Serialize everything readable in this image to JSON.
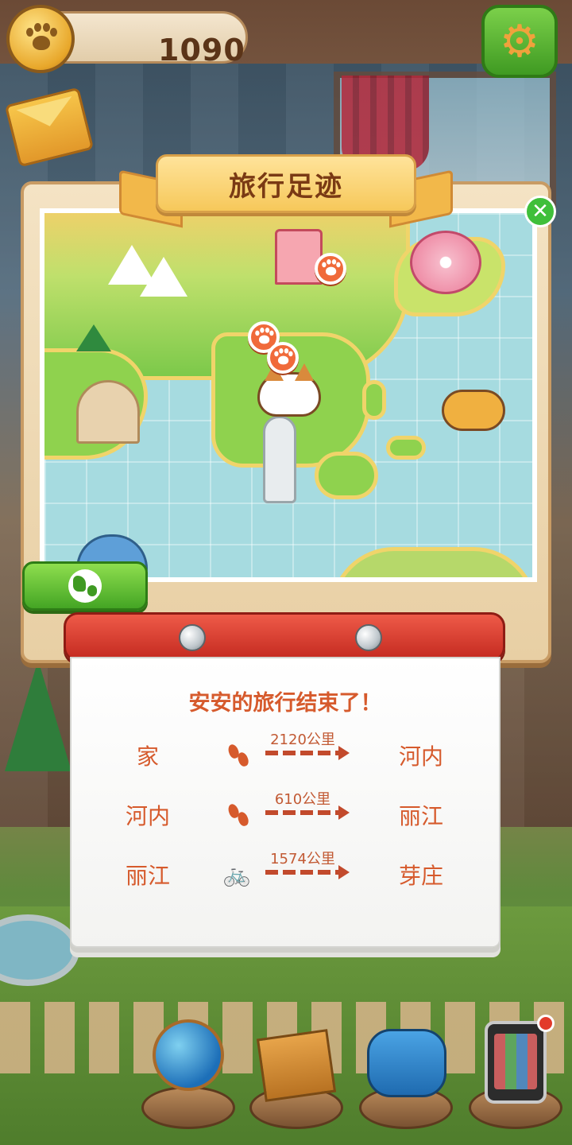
{
  "hud": {
    "coins": "1090",
    "settings_icon": "gear-icon",
    "coin_icon": "paw-coin-icon"
  },
  "panel": {
    "title": "旅行足迹",
    "close_icon": "close-icon",
    "close_glyph": "✕",
    "globe_button_icon": "globe-icon",
    "map_markers": [
      "temple",
      "cherry-blossom",
      "panda",
      "taj-mahal",
      "statue",
      "corgi-pin",
      "boat-dog",
      "shark",
      "kangaroo-dog",
      "opera-house"
    ]
  },
  "summary": {
    "headline": "安安的旅行结束了！",
    "routes": [
      {
        "from": "家",
        "mode": "walk",
        "mode_icon": "footprints-icon",
        "distance": "2120公里",
        "to": "河内"
      },
      {
        "from": "河内",
        "mode": "walk",
        "mode_icon": "footprints-icon",
        "distance": "610公里",
        "to": "丽江"
      },
      {
        "from": "丽江",
        "mode": "bike",
        "mode_icon": "bicycle-icon",
        "mode_glyph": "🚲",
        "distance": "1574公里",
        "to": "芽庄"
      }
    ]
  },
  "dock": {
    "items": [
      "globe-icon",
      "toolbox-icon",
      "telephone-icon",
      "mobile-phone-icon"
    ]
  },
  "colors": {
    "accent_text": "#d65a2c",
    "ribbon": "#f6c85a",
    "scroll_red": "#c42a20",
    "button_green": "#44a524"
  }
}
